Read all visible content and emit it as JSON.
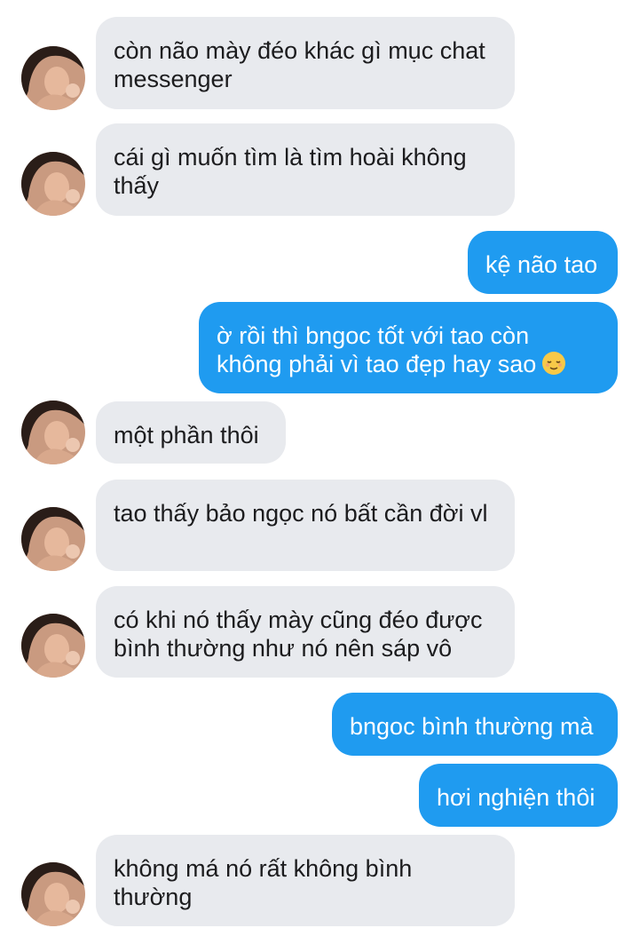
{
  "messages": [
    {
      "side": "in",
      "text": "còn não mày đéo khác gì mục chat messenger"
    },
    {
      "side": "in",
      "text": "cái gì muốn tìm là tìm hoài không thấy"
    },
    {
      "side": "out",
      "text": "kệ não tao"
    },
    {
      "side": "out",
      "text": "ờ rồi thì bngoc tốt với tao còn không phải vì tao đẹp hay sao",
      "emoji": "relieved-face-emoji"
    },
    {
      "side": "in",
      "text": "một phần thôi"
    },
    {
      "side": "in",
      "text": "tao thấy bảo ngọc nó bất cần đời vl"
    },
    {
      "side": "in",
      "text": "có khi nó thấy mày cũng đéo được bình thường như nó nên sáp vô"
    },
    {
      "side": "out",
      "text": "bngoc bình thường mà"
    },
    {
      "side": "out",
      "text": "hơi nghiện thôi"
    },
    {
      "side": "in",
      "text": "không má nó rất không bình thường"
    }
  ],
  "colors": {
    "incoming_bubble": "#e8eaee",
    "outgoing_bubble": "#1f9bf0",
    "incoming_text": "#1c1c1e",
    "outgoing_text": "#ffffff"
  }
}
